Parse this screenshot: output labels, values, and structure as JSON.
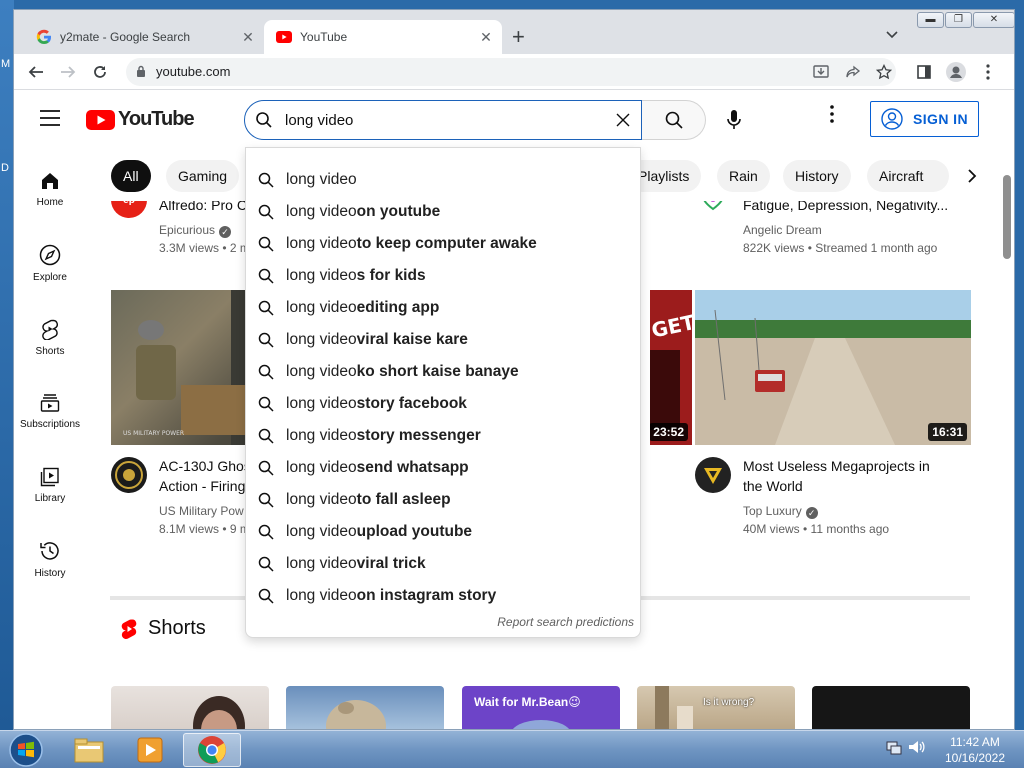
{
  "desktop": {
    "letters": [
      "M",
      "D"
    ]
  },
  "browser": {
    "tabs": [
      {
        "title": "y2mate - Google Search",
        "favicon": "google-g-icon"
      },
      {
        "title": "YouTube",
        "favicon": "youtube-icon"
      }
    ],
    "address": "youtube.com"
  },
  "youtube": {
    "logo_text": "YouTube",
    "search": {
      "value": "long video",
      "placeholder": "Search"
    },
    "sign_in": "SIGN IN",
    "sidebar": [
      {
        "label": "Home",
        "icon": "home-icon"
      },
      {
        "label": "Explore",
        "icon": "compass-icon"
      },
      {
        "label": "Shorts",
        "icon": "shorts-icon"
      },
      {
        "label": "Subscriptions",
        "icon": "subscriptions-icon"
      },
      {
        "label": "Library",
        "icon": "library-icon"
      },
      {
        "label": "History",
        "icon": "history-icon"
      }
    ],
    "chips": [
      "All",
      "Gaming",
      "Playlists",
      "Rain",
      "History",
      "Aircraft"
    ],
    "videos_top": [
      {
        "title": "Alfredo: Pro C",
        "channel": "Epicurious",
        "meta": "3.3M views • 2 m"
      },
      {
        "title": "Fatigue, Depression, Negativity...",
        "channel": "Angelic Dream",
        "meta": "822K views • Streamed 1 month ago"
      }
    ],
    "videos": [
      {
        "title_line1": "AC-130J Ghos",
        "title_line2": "Action - Firing",
        "channel": "US Military Pow",
        "meta": "8.1M views • 9 m",
        "thumb_text": "US MILITARY POWER"
      },
      {
        "duration": "23:52",
        "thumb_text": "GET"
      },
      {
        "title_line1": "Most Useless Megaprojects in",
        "title_line2": "the World",
        "channel": "Top Luxury",
        "meta": "40M views • 11 months ago",
        "duration": "16:31"
      }
    ],
    "shorts_title": "Shorts",
    "shorts": [
      {
        "caption": ""
      },
      {
        "caption": ""
      },
      {
        "caption": "Wait for Mr.Bean😉"
      },
      {
        "caption": "Is it wrong?"
      },
      {
        "caption": ""
      }
    ],
    "suggestions": [
      {
        "prefix": "long video",
        "suffix": ""
      },
      {
        "prefix": "long video",
        "suffix": " on youtube"
      },
      {
        "prefix": "long video",
        "suffix": " to keep computer awake"
      },
      {
        "prefix": "long video",
        "suffix": "s for kids"
      },
      {
        "prefix": "long video",
        "suffix": " editing app"
      },
      {
        "prefix": "long video",
        "suffix": " viral kaise kare"
      },
      {
        "prefix": "long video",
        "suffix": " ko short kaise banaye"
      },
      {
        "prefix": "long video",
        "suffix": " story facebook"
      },
      {
        "prefix": "long video",
        "suffix": " story messenger"
      },
      {
        "prefix": "long video",
        "suffix": " send whatsapp"
      },
      {
        "prefix": "long video",
        "suffix": " to fall asleep"
      },
      {
        "prefix": "long video",
        "suffix": " upload youtube"
      },
      {
        "prefix": "long video",
        "suffix": " viral trick"
      },
      {
        "prefix": "long video",
        "suffix": " on instagram story"
      }
    ],
    "report": "Report search predictions"
  },
  "taskbar": {
    "apps": [
      "start-orb-icon",
      "file-explorer-icon",
      "media-player-icon",
      "chrome-icon"
    ],
    "time": "11:42 AM",
    "date": "10/16/2022"
  },
  "colors": {
    "youtube_red": "#ff0000",
    "link_blue": "#065fd4",
    "search_border": "#1c62b9"
  }
}
